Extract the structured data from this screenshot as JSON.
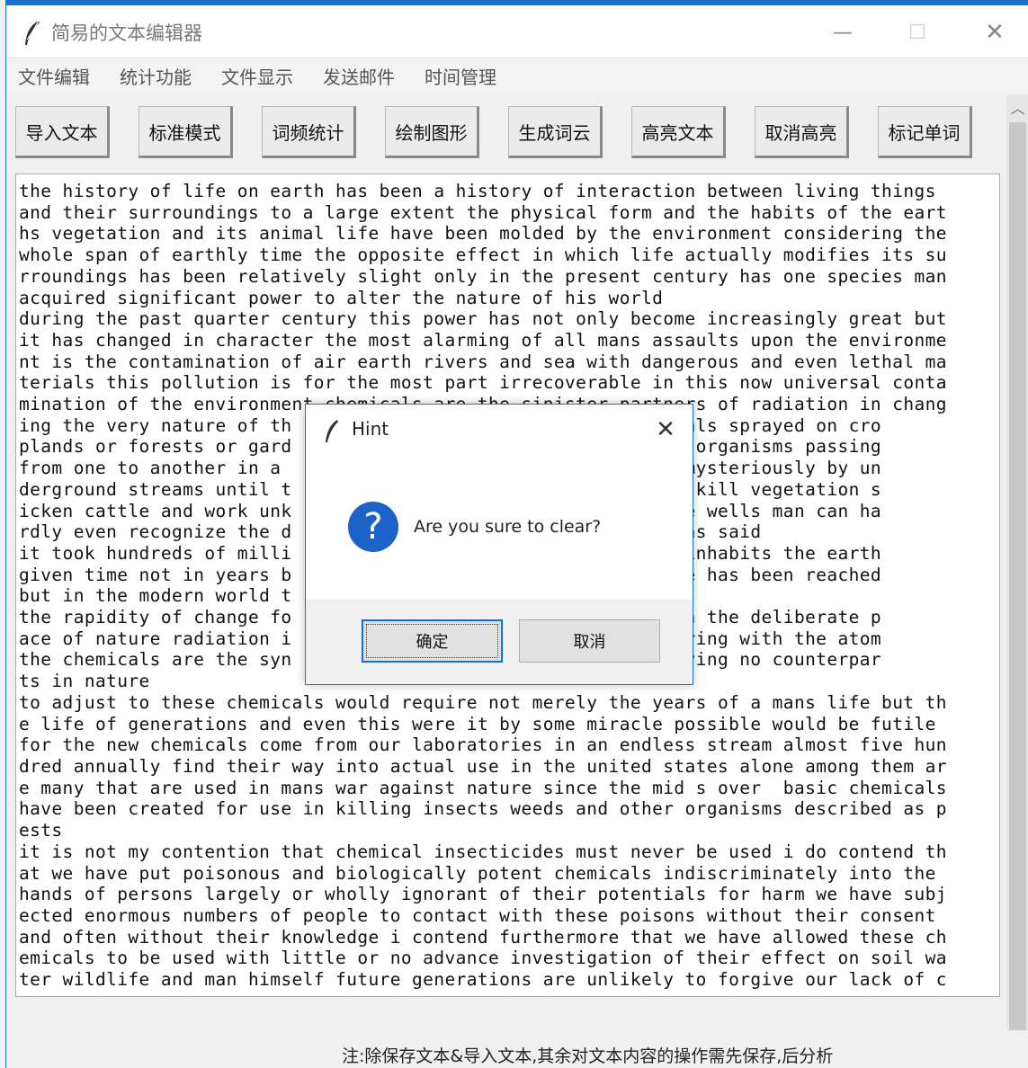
{
  "window": {
    "title": "简易的文本编辑器",
    "controls": {
      "minimize": "—",
      "maximize": "☐",
      "close": "✕"
    }
  },
  "menu": [
    "文件编辑",
    "统计功能",
    "文件显示",
    "发送邮件",
    "时间管理"
  ],
  "toolbar": [
    "导入文本",
    "标准模式",
    "词频统计",
    "绘制图形",
    "生成词云",
    "高亮文本",
    "取消高亮",
    "标记单词"
  ],
  "editor": {
    "lines": [
      "the history of life on earth has been a history of interaction between living things",
      "and their surroundings to a large extent the physical form and the habits of the eart",
      "hs vegetation and its animal life have been molded by the environment considering the",
      "whole span of earthly time the opposite effect in which life actually modifies its su",
      "rroundings has been relatively slight only in the present century has one species man",
      "acquired significant power to alter the nature of his world",
      "during the past quarter century this power has not only become increasingly great but",
      "it has changed in character the most alarming of all mans assaults upon the environme",
      "nt is the contamination of air earth rivers and sea with dangerous and even lethal ma",
      "terials this pollution is for the most part irrecoverable in this now universal conta",
      "mination of the environment chemicals are the sinister partners of radiation in chang",
      "ing the very nature of th                            e chemicals sprayed on cro",
      "plands or forests or gard                              living organisms passing",
      "from one to another in a                             ey pass mysteriously by un",
      "derground streams until t                            rms that kill vegetation s",
      "icken cattle and work unk                            once pure wells man can ha",
      "rdly even recognize the d                            entist has said",
      "it took hundreds of milli                            hat now inhabits the earth",
      "given time not in years b                              balance has been reached",
      "but in the modern world t",
      "the rapidity of change fo                            ther than the deliberate p",
      "ace of nature radiation i                            ns tampering with the atom",
      "the chemicals are the syn                             mind having no counterpar",
      "ts in nature",
      "to adjust to these chemicals would require not merely the years of a mans life but th",
      "e life of generations and even this were it by some miracle possible would be futile",
      "for the new chemicals come from our laboratories in an endless stream almost five hun",
      "dred annually find their way into actual use in the united states alone among them ar",
      "e many that are used in mans war against nature since the mid s over  basic chemicals",
      "have been created for use in killing insects weeds and other organisms described as p",
      "ests",
      "it is not my contention that chemical insecticides must never be used i do contend th",
      "at we have put poisonous and biologically potent chemicals indiscriminately into the",
      "hands of persons largely or wholly ignorant of their potentials for harm we have subj",
      "ected enormous numbers of people to contact with these poisons without their consent",
      "and often without their knowledge i contend furthermore that we have allowed these ch",
      "emicals to be used with little or no advance investigation of their effect on soil wa",
      "ter wildlife and man himself future generations are unlikely to forgive our lack of c"
    ]
  },
  "footer_note": "注:除保存文本&导入文本,其余对文本内容的操作需先保存,后分析",
  "dialog": {
    "title": "Hint",
    "close": "✕",
    "icon": "?",
    "message": "Are you sure to clear?",
    "ok_label": "确定",
    "cancel_label": "取消"
  },
  "colors": {
    "accent": "#1a73c8",
    "question_icon": "#1c63c9"
  }
}
